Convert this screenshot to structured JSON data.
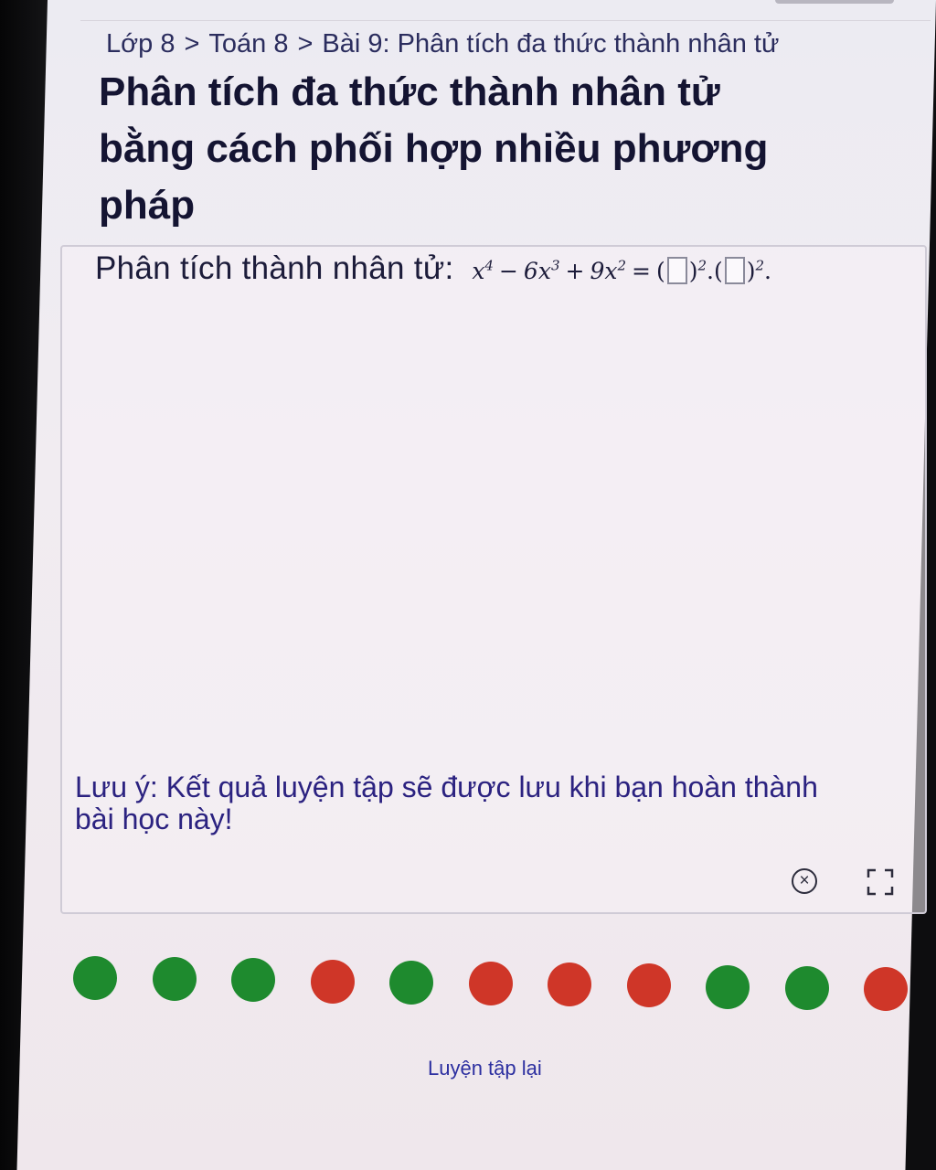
{
  "breadcrumb": {
    "items": [
      "Lớp 8",
      "Toán 8",
      "Bài 9: Phân tích đa thức thành nhân tử"
    ],
    "separator": ">"
  },
  "page": {
    "title_line1": "Phân tích đa thức thành nhân tử",
    "title_line2": "bằng cách phối hợp nhiều phương",
    "title_line3": "pháp"
  },
  "exercise": {
    "prompt": "Phân tích thành nhân tử:",
    "note_line1": "Lưu ý: Kết quả luyện tập sẽ được lưu khi bạn hoàn thành",
    "note_line2": "bài học này!"
  },
  "toolbar": {
    "close_icon": "close-icon",
    "fullscreen_icon": "fullscreen-icon"
  },
  "progress": {
    "results": [
      "correct",
      "correct",
      "correct",
      "wrong",
      "correct",
      "wrong",
      "wrong",
      "wrong",
      "correct",
      "correct",
      "wrong"
    ],
    "colors": {
      "correct": "#1e8a2e",
      "wrong": "#cf3628"
    }
  },
  "footer": {
    "retry_label": "Luyện tập lại"
  }
}
